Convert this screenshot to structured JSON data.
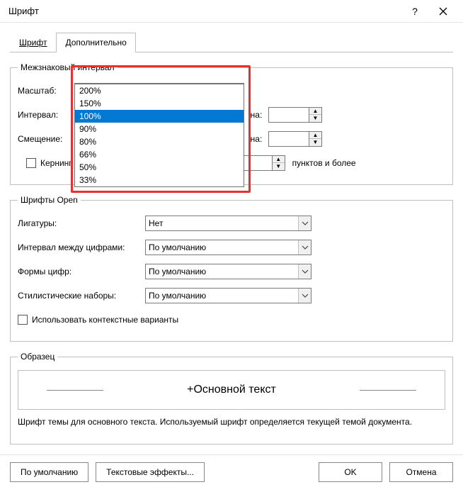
{
  "window": {
    "title": "Шрифт"
  },
  "tabs": {
    "font": "Шрифт",
    "advanced": "Дополнительно"
  },
  "spacingGroup": {
    "legend": "Межзнаковый интервал",
    "scaleLabel": "Масштаб:",
    "scaleValue": "100%",
    "intervalLabel": "Интервал:",
    "naLabel": "на:",
    "offsetLabel": "Смещение:",
    "kerningLabel": "Кернинг",
    "kerningSuffix": "пунктов и более"
  },
  "scaleOptions": [
    "200%",
    "150%",
    "100%",
    "90%",
    "80%",
    "66%",
    "50%",
    "33%"
  ],
  "scaleSelectedIndex": 2,
  "opentypeGroup": {
    "legend": "Шрифты Open",
    "ligaturesLabel": "Лигатуры:",
    "ligaturesValue": "Нет",
    "digitSpacingLabel": "Интервал между цифрами:",
    "digitFormsLabel": "Формы цифр:",
    "stylisticLabel": "Стилистические наборы:",
    "defaultValue": "По умолчанию",
    "contextualLabel": "Использовать контекстные варианты"
  },
  "sample": {
    "legend": "Образец",
    "text": "+Основной текст",
    "note": "Шрифт темы для основного текста. Используемый шрифт определяется текущей темой документа."
  },
  "buttons": {
    "defaults": "По умолчанию",
    "effects": "Текстовые эффекты...",
    "ok": "OK",
    "cancel": "Отмена"
  }
}
